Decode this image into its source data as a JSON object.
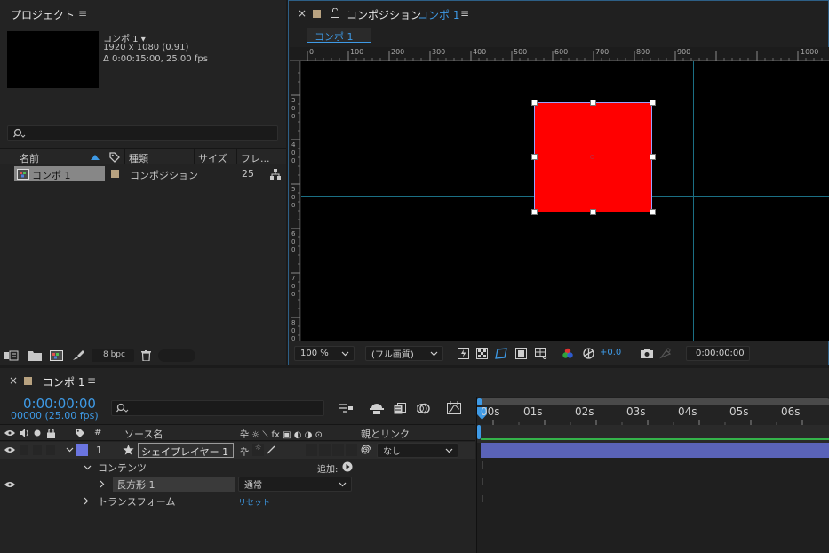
{
  "project": {
    "title": "プロジェクト",
    "menu_icon": "hamburger-icon",
    "comp_name": "コンポ 1 ▾",
    "comp_size": "1920 x 1080 (0.91)",
    "comp_duration": "Δ 0:00:15:00, 25.00 fps",
    "search_icon": "search-icon",
    "columns": [
      "名前",
      "種類",
      "サイズ",
      "フレ..."
    ],
    "item": {
      "name": "コンポ 1",
      "type": "コンポジション",
      "frames": "25"
    },
    "bpc": "8 bpc"
  },
  "comp_panel": {
    "close": "×",
    "title": "コンポジション",
    "title_accent": "コンポ 1",
    "menu": "≡",
    "tab": "コンポ 1",
    "ruler_h": [
      "0",
      "100",
      "200",
      "300",
      "400",
      "500",
      "600",
      "700",
      "800",
      "900",
      "1000"
    ],
    "ruler_v": [
      "3\n0\n0",
      "4\n0\n0",
      "5\n0\n0",
      "6\n0\n0",
      "7\n0\n0",
      "8\n0\n0"
    ],
    "shape_color": "#ff0000",
    "zoom": "100 %",
    "quality": "(フル画質)",
    "exposure": "+0.0",
    "timecode": "0:00:00:00"
  },
  "timeline": {
    "close": "×",
    "title": "コンポ 1",
    "menu": "≡",
    "timecode": "0:00:00:00",
    "frames": "00000 (25.00 fps)",
    "search_icon": "search-icon",
    "col_number": "#",
    "col_source": "ソース名",
    "col_parent": "親とリンク",
    "layer_number": "1",
    "layer_name": "シェイプレイヤー 1",
    "parent_value": "なし",
    "contents_label": "コンテンツ",
    "add_label": "追加:",
    "rect_label": "長方形 1",
    "blend_mode": "通常",
    "transform_label": "トランスフォーム",
    "reset_label": "リセット",
    "time_labels": [
      "00s",
      "01s",
      "02s",
      "03s",
      "04s",
      "05s",
      "06s"
    ],
    "accent_color": "#3e9ae6",
    "layer_bar_color": "#5a63b8"
  }
}
